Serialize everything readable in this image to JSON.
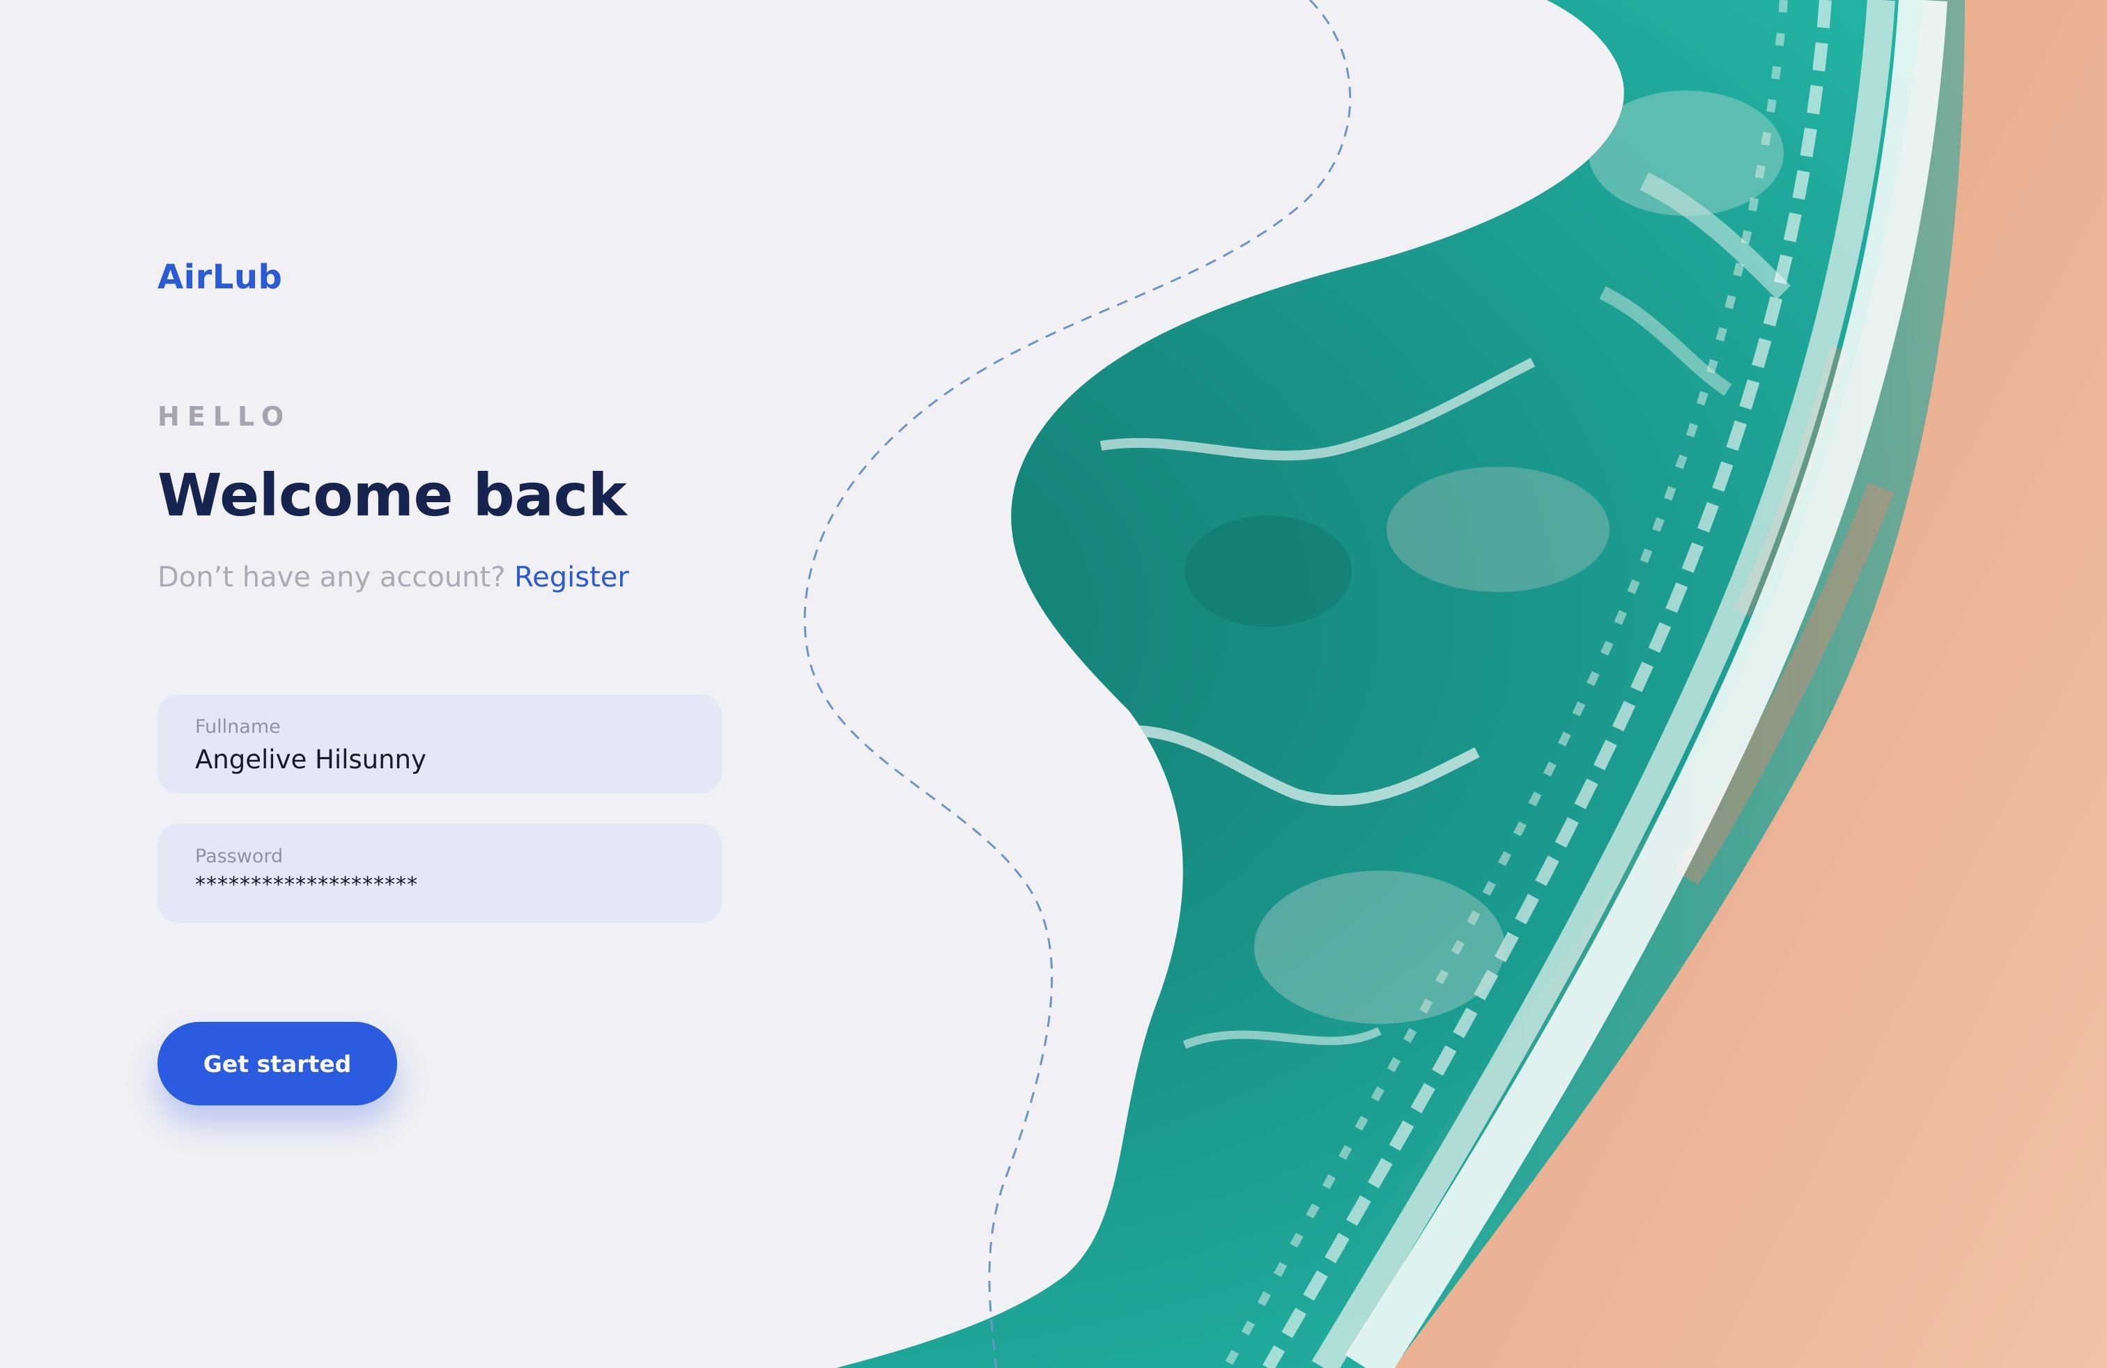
{
  "brand": {
    "name": "AirLub"
  },
  "login": {
    "eyebrow": "HELLO",
    "headline": "Welcome back",
    "prompt": "Don’t have any account?",
    "register_label": "Register"
  },
  "form": {
    "fullname_label": "Fullname",
    "fullname_value": "Angelive Hilsunny",
    "password_label": "Password",
    "password_value": "********************",
    "submit_label": "Get started"
  },
  "colors": {
    "accent": "#2a5bd7",
    "headline": "#16244f",
    "muted": "#a9abb6",
    "field_bg": "#e4e7f5",
    "page_bg": "#f0f0f5"
  }
}
